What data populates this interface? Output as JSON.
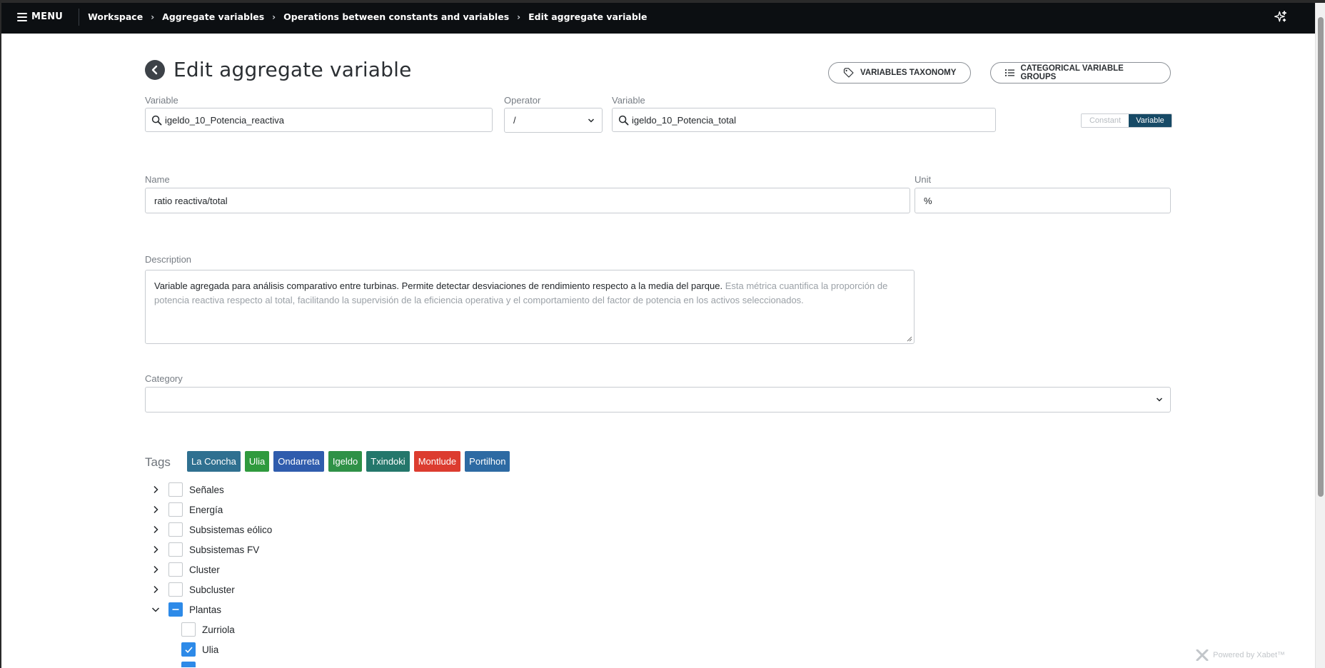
{
  "topbar": {
    "menu_label": "MENU",
    "breadcrumb": [
      "Workspace",
      "Aggregate variables",
      "Operations between constants and variables",
      "Edit aggregate variable"
    ],
    "background": "#0c0f12",
    "ai_icon": "sparkles-icon"
  },
  "page": {
    "title": "Edit aggregate variable",
    "taxonomy_button": "VARIABLES TAXONOMY",
    "groups_button": "CATEGORICAL VARIABLE GROUPS"
  },
  "operation": {
    "variable1_label": "Variable",
    "variable1_value": "igeldo_10_Potencia_reactiva",
    "operator_label": "Operator",
    "operator_value": "/",
    "variable2_label": "Variable",
    "variable2_value": "igeldo_10_Potencia_total",
    "toggle_constant": "Constant",
    "toggle_variable": "Variable",
    "toggle_active": "Variable",
    "active_color": "#174a66"
  },
  "form": {
    "name_label": "Name",
    "name_value": "ratio reactiva/total",
    "unit_label": "Unit",
    "unit_value": "%",
    "description_label": "Description",
    "description_main": "Variable agregada para análisis comparativo entre turbinas. Permite detectar desviaciones de rendimiento respecto a la media del parque.",
    "description_rest": " Esta métrica cuantifica la proporción de potencia reactiva respecto al total, facilitando la supervisión de la eficiencia operativa y el comportamiento del factor de potencia en los activos seleccionados.",
    "category_label": "Category",
    "category_value": ""
  },
  "tags": {
    "label": "Tags",
    "items": [
      {
        "label": "La Concha",
        "color": "#2f7090"
      },
      {
        "label": "Ulia",
        "color": "#2f9a3e"
      },
      {
        "label": "Ondarreta",
        "color": "#2f5cad"
      },
      {
        "label": "Igeldo",
        "color": "#2f9147"
      },
      {
        "label": "Txindoki",
        "color": "#24776b"
      },
      {
        "label": "Montlude",
        "color": "#dc3c2f"
      },
      {
        "label": "Portilhon",
        "color": "#2d6aa3"
      }
    ]
  },
  "tree": {
    "items": [
      {
        "label": "Señales",
        "state": "collapsed",
        "checked": "none"
      },
      {
        "label": "Energía",
        "state": "collapsed",
        "checked": "none"
      },
      {
        "label": "Subsistemas eólico",
        "state": "collapsed",
        "checked": "none"
      },
      {
        "label": "Subsistemas FV",
        "state": "collapsed",
        "checked": "none"
      },
      {
        "label": "Cluster",
        "state": "collapsed",
        "checked": "none"
      },
      {
        "label": "Subcluster",
        "state": "collapsed",
        "checked": "none"
      },
      {
        "label": "Plantas",
        "state": "expanded",
        "checked": "partial"
      }
    ],
    "children": [
      {
        "label": "Zurriola",
        "checked": "none"
      },
      {
        "label": "Ulia",
        "checked": "checked"
      }
    ],
    "check_color": "#2d8ae8"
  },
  "footer": {
    "powered_by": "Powered by Xabet™"
  }
}
